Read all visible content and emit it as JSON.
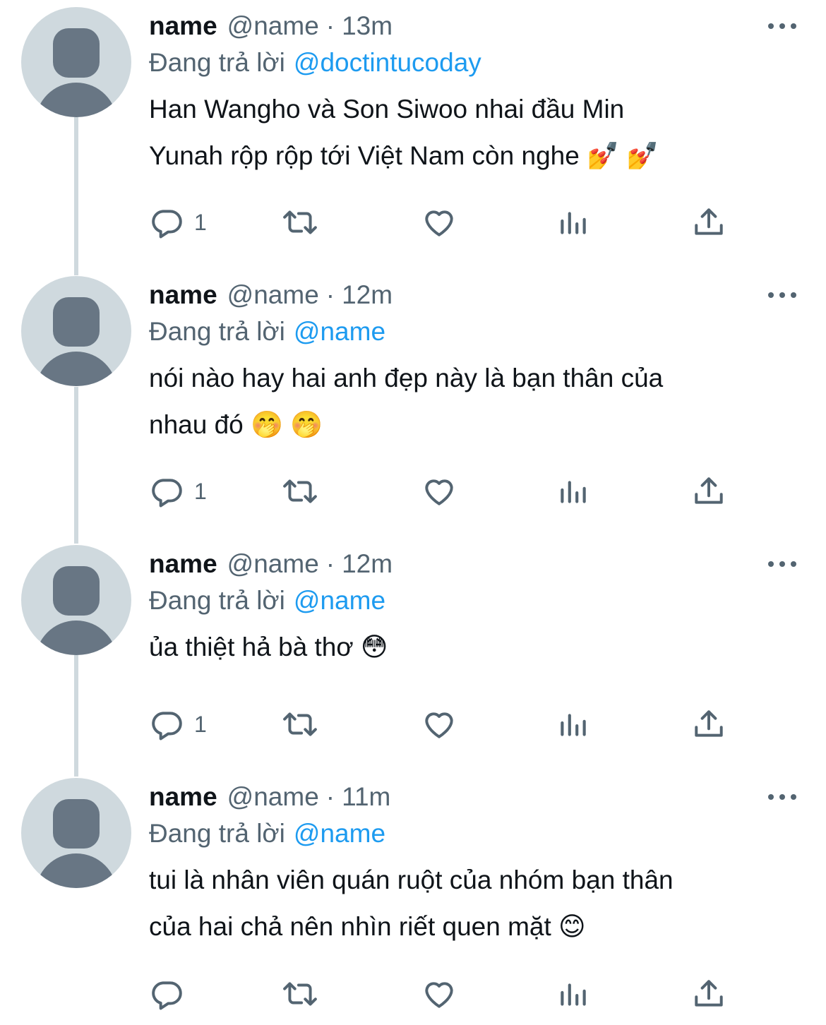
{
  "tweets": [
    {
      "name": "name",
      "handle": "@name",
      "separator": "·",
      "time": "13m",
      "reply_label": "Đang trả lời",
      "reply_to": "@doctintucoday",
      "text_lines": [
        "Han Wangho và Son Siwoo nhai đầu Min",
        "Yunah rộp rộp tới Việt Nam còn nghe 💅 💅"
      ],
      "reply_count": "1"
    },
    {
      "name": "name",
      "handle": "@name",
      "separator": "·",
      "time": "12m",
      "reply_label": "Đang trả lời",
      "reply_to": "@name",
      "text_lines": [
        "nói nào hay hai anh đẹp này là bạn thân của",
        "nhau đó 🤭 🤭"
      ],
      "reply_count": "1"
    },
    {
      "name": "name",
      "handle": "@name",
      "separator": "·",
      "time": "12m",
      "reply_label": "Đang trả lời",
      "reply_to": "@name",
      "text_lines": [
        "ủa thiệt hả bà thơ 😳"
      ],
      "reply_count": "1"
    },
    {
      "name": "name",
      "handle": "@name",
      "separator": "·",
      "time": "11m",
      "reply_label": "Đang trả lời",
      "reply_to": "@name",
      "text_lines": [
        "tui là nhân viên quán ruột của nhóm bạn thân",
        "của hai chả nên nhìn riết quen mặt 😊"
      ],
      "reply_count": ""
    }
  ],
  "icons": {
    "avatar": "default-profile-avatar",
    "more": "more-horizontal-icon",
    "reply": "reply-bubble-icon",
    "retweet": "retweet-icon",
    "like": "heart-icon",
    "views": "analytics-bars-icon",
    "share": "share-upload-icon"
  },
  "colors": {
    "primary_text": "#0f1419",
    "secondary_text": "#536471",
    "link": "#1d9bf0",
    "avatar_bg": "#cfd9de",
    "avatar_fg": "#687684",
    "thread_line": "#cfd9de"
  }
}
